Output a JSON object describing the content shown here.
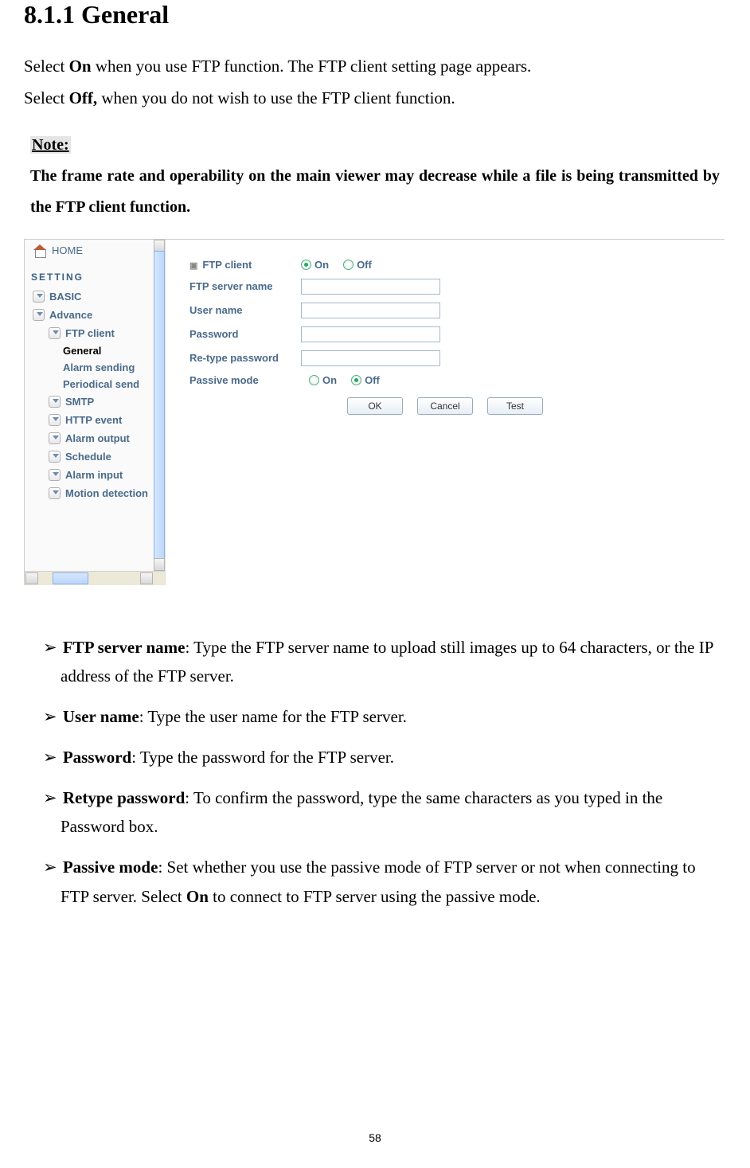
{
  "heading": "8.1.1 General",
  "intro": {
    "line1_pre": "Select ",
    "line1_bold": "On",
    "line1_post": " when you use FTP function. The FTP client setting page appears.",
    "line2_pre": "Select ",
    "line2_bold": "Off,",
    "line2_post": " when you do not wish to use the FTP client function."
  },
  "note": {
    "label": "Note:",
    "body": "The frame rate and operability on the main viewer may decrease while a file is being transmitted by the FTP client function."
  },
  "ui": {
    "home": "HOME",
    "setting_hdr": "SETTING",
    "basic": "BASIC",
    "advance": "Advance",
    "tree": {
      "ftp_client": "FTP client",
      "general": "General",
      "alarm_sending": "Alarm sending",
      "periodical_send": "Periodical send",
      "smtp": "SMTP",
      "http_event": "HTTP event",
      "alarm_output": "Alarm output",
      "schedule": "Schedule",
      "alarm_input": "Alarm input",
      "motion_detection": "Motion detection"
    },
    "form": {
      "ftp_client_label": "FTP client",
      "on": "On",
      "off": "Off",
      "ftp_server_name": "FTP server name",
      "user_name": "User name",
      "password": "Password",
      "retype_password": "Re-type password",
      "passive_mode": "Passive mode",
      "ok": "OK",
      "cancel": "Cancel",
      "test": "Test"
    }
  },
  "fields": [
    {
      "name": "FTP server name",
      "desc": ": Type the FTP server name to upload still images up to 64 characters, or the IP address of the FTP server."
    },
    {
      "name": "User name",
      "desc": ": Type the user name for the FTP server."
    },
    {
      "name": "Password",
      "desc": ": Type the password for the FTP server."
    },
    {
      "name": "Retype password",
      "desc": ": To confirm the password, type the same characters as you typed in the Password box."
    }
  ],
  "passive": {
    "name": "Passive mode",
    "pre": ": Set whether you use the passive mode of FTP server or not when connecting to FTP server. Select ",
    "bold": "On",
    "post": " to connect to FTP server using the passive mode."
  },
  "page_num": "58",
  "arrow": "➢"
}
